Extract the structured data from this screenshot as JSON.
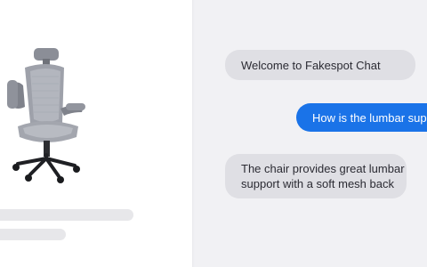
{
  "product": {
    "image_name": "office-chair-image"
  },
  "chat": {
    "messages": [
      {
        "sender": "bot",
        "text": "Welcome to Fakespot Chat"
      },
      {
        "sender": "user",
        "text": "How is the lumbar sup"
      },
      {
        "sender": "bot",
        "lines": [
          "The chair provides great lumbar",
          "support with a soft mesh back"
        ]
      }
    ]
  },
  "colors": {
    "background": "#f1f1f4",
    "card": "#ffffff",
    "bot_bubble": "#dfdfe4",
    "user_bubble": "#1a73e8",
    "skeleton": "#e7e7ea"
  }
}
